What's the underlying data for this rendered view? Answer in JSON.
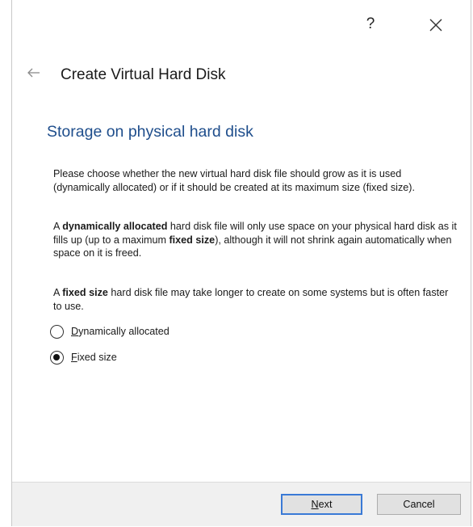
{
  "title_bar": {
    "help_label": "?",
    "close_icon": "close-icon"
  },
  "wizard": {
    "back_icon": "back-arrow-icon",
    "title": "Create Virtual Hard Disk",
    "heading": "Storage on physical hard disk",
    "paragraph1": "Please choose whether the new virtual hard disk file should grow as it is used (dynamically allocated) or if it should be created at its maximum size (fixed size).",
    "paragraph2": {
      "part1": "A ",
      "bold1": "dynamically allocated",
      "part2": " hard disk file will only use space on your physical hard disk as it fills up (up to a maximum ",
      "bold2": "fixed size",
      "part3": "), although it will not shrink again automatically when space on it is freed."
    },
    "paragraph3": {
      "part1": "A ",
      "bold1": "fixed size",
      "part2": " hard disk file may take longer to create on some systems but is often faster to use."
    },
    "options": [
      {
        "mnemonic": "D",
        "rest": "ynamically allocated",
        "checked": false
      },
      {
        "mnemonic": "F",
        "rest": "ixed size",
        "checked": true
      }
    ]
  },
  "footer": {
    "next": {
      "mnemonic": "N",
      "rest": "ext"
    },
    "cancel_label": "Cancel"
  }
}
